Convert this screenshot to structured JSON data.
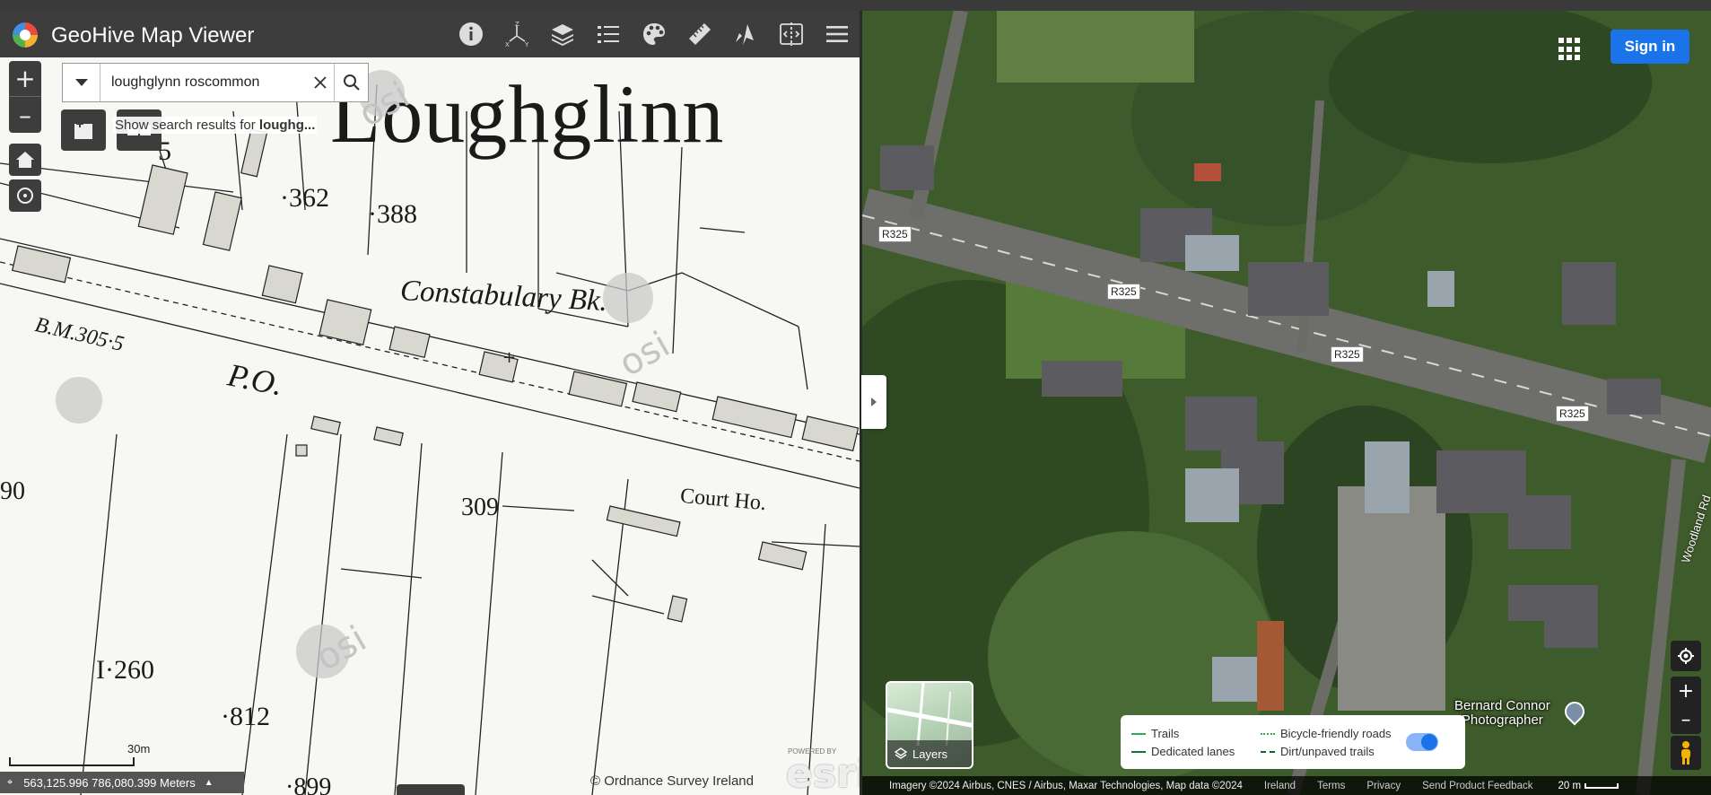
{
  "app": {
    "title": "GeoHive Map Viewer",
    "toolbar_icons": [
      "info-icon",
      "coordinate-axes-icon",
      "layers-stack-icon",
      "legend-list-icon",
      "basemap-palette-icon",
      "measure-ruler-icon",
      "select-draw-icon",
      "swipe-compare-icon",
      "menu-icon"
    ]
  },
  "left_map": {
    "search": {
      "value": "loughglynn roscommon",
      "suggestion_prefix": "Show search results for ",
      "suggestion_term": "loughg..."
    },
    "zoom": {
      "in": "+",
      "out": "–"
    },
    "map_labels": {
      "town": "Loughglinn",
      "constabulary": "Constabulary Bk.",
      "post_office": "P.O.",
      "benchmark": "B.M.305·5",
      "court_house": "Court Ho.",
      "parcel_362": "·362",
      "parcel_388": "·388",
      "parcel_309": "309",
      "parcel_1260": "I·260",
      "parcel_812": "·812",
      "parcel_899": "·899",
      "parcel_90": "90",
      "parcel_5": "5",
      "watermarks": [
        "osi",
        "osi",
        "osi"
      ]
    },
    "scale_label": "30m",
    "coordinates": "563,125.996 786,080.399 Meters",
    "attribution": "© Ordnance Survey Ireland",
    "esri_powered": "POWERED BY",
    "esri_logo": "esri"
  },
  "right_map": {
    "apps_icon": "apps-grid-icon",
    "sign_in": "Sign in",
    "road_labels": [
      "R325",
      "R325",
      "R325",
      "R325"
    ],
    "street_name": "Woodland Rd",
    "place": {
      "name_line1": "Bernard Connor",
      "name_line2": "Photographer"
    },
    "layers_label": "Layers",
    "legend": {
      "trails": "Trails",
      "dedicated": "Dedicated lanes",
      "bicycle": "Bicycle-friendly roads",
      "dirt": "Dirt/unpaved trails",
      "colors": {
        "trails": "#34a853",
        "dedicated": "#137333",
        "bicycle": "#34a853",
        "dirt": "#0d652d"
      }
    },
    "footer": {
      "imagery": "Imagery ©2024 Airbus, CNES / Airbus, Maxar Technologies, Map data ©2024",
      "country": "Ireland",
      "terms": "Terms",
      "privacy": "Privacy",
      "feedback": "Send Product Feedback",
      "scale": "20 m"
    },
    "colors": {
      "sign_in": "#1a73e8"
    }
  }
}
